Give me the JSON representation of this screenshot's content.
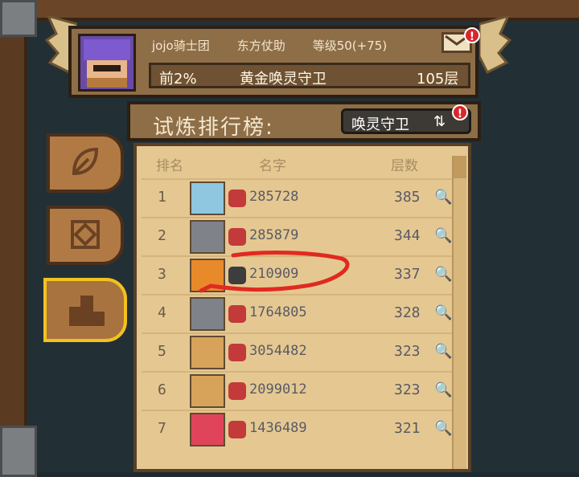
{
  "profile": {
    "guild": "jojo骑士团",
    "name": "东方仗助",
    "level": "等级50(+75)",
    "percentile": "前2%",
    "tier": "黄金唤灵守卫",
    "floors": "105层"
  },
  "leaderboard": {
    "title": "试炼排行榜:",
    "mode_label": "唤灵守卫",
    "headers": {
      "rank": "排名",
      "name": "名字",
      "floors": "层数"
    },
    "rows": [
      {
        "rank": "1",
        "id": "285728",
        "floors": "385",
        "pet_color": "#8fc6e0",
        "badge_color": "#c23a3a"
      },
      {
        "rank": "2",
        "id": "285879",
        "floors": "344",
        "pet_color": "#7f8389",
        "badge_color": "#c23a3a"
      },
      {
        "rank": "3",
        "id": "210909",
        "floors": "337",
        "pet_color": "#e88a2a",
        "badge_color": "#3d3d3d"
      },
      {
        "rank": "4",
        "id": "1764805",
        "floors": "328",
        "pet_color": "#7f8389",
        "badge_color": "#c23a3a"
      },
      {
        "rank": "5",
        "id": "3054482",
        "floors": "323",
        "pet_color": "#d7a35a",
        "badge_color": "#c23a3a"
      },
      {
        "rank": "6",
        "id": "2099012",
        "floors": "323",
        "pet_color": "#d7a35a",
        "badge_color": "#c23a3a"
      },
      {
        "rank": "7",
        "id": "1436489",
        "floors": "321",
        "pet_color": "#e0445a",
        "badge_color": "#c23a3a"
      }
    ]
  },
  "icons": {
    "mail": "mail-icon",
    "alert": "!",
    "swap": "swap-icon",
    "search": "magnifier-icon"
  },
  "colors": {
    "panel": "#8e6e47",
    "board": "#e5c891",
    "highlight": "#f2c21e",
    "annotation": "#e02a20"
  }
}
